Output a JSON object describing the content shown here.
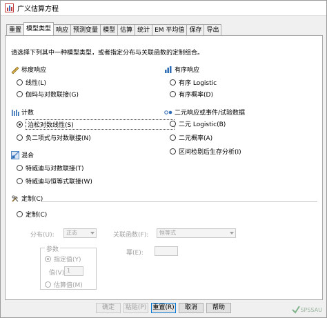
{
  "window": {
    "title": "广义估算方程"
  },
  "tabs": [
    "重置",
    "模型类型",
    "响应",
    "预测变量",
    "模型",
    "估算",
    "统计",
    "EM 平均值",
    "保存",
    "导出"
  ],
  "instruction": "请选择下列其中一种模型类型，或者指定分布与关联函数的定制组合。",
  "scale": {
    "heading": "标度响应",
    "opt1": "线性(L)",
    "opt2": "伽玛与对数联接(G)"
  },
  "ordinal": {
    "heading": "有序响应",
    "opt1": "有序 Logistic",
    "opt2": "有序概率(D)"
  },
  "counts": {
    "heading": "计数",
    "opt1": "泊松对数线性(S)",
    "opt2": "负二项式与对数联接(N)"
  },
  "binary": {
    "heading": "二元响应或事件/试验数据",
    "opt1": "二元 Logistic(B)",
    "opt2": "二元概率(A)",
    "opt3": "区间检剔后生存分析(I)"
  },
  "mixture": {
    "heading": "混合",
    "opt1": "特威迪与对数联接(T)",
    "opt2": "特威迪与恒等式联接(W)"
  },
  "custom": {
    "heading": "定制(C)",
    "radio": "定制(C)",
    "dist_label": "分布(U):",
    "dist_value": "正态",
    "link_label": "关联函数(F):",
    "link_value": "恒等式",
    "params_title": "参数",
    "specify": "指定值(Y)",
    "value_label": "值(V):",
    "value": "1",
    "estimate": "估算值(M)",
    "power_label": "幂(E):"
  },
  "buttons": {
    "ok": "确定",
    "paste": "粘贴(P)",
    "reset": "重置(R)",
    "cancel": "取消",
    "help": "帮助"
  },
  "watermark": "SPSSAU"
}
